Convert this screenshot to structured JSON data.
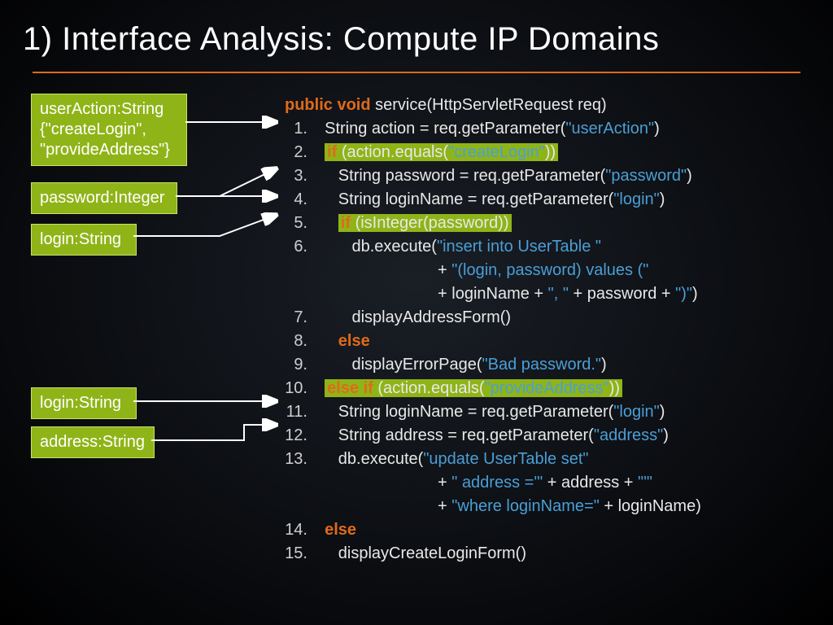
{
  "title": "1) Interface Analysis: Compute IP Domains",
  "boxes": {
    "userAction": "userAction:String {\"createLogin\", \"provideAddress\"}",
    "password": "password:Integer",
    "login1": "login:String",
    "login2": "login:String",
    "address": "address:String"
  },
  "code": {
    "sig": {
      "pre": "public void",
      "rest": " service(HttpServletRequest req)"
    },
    "l1": {
      "n": "1.",
      "a": "String action = req.getParameter(",
      "s": "\"userAction\"",
      "b": ")"
    },
    "l2": {
      "n": "2.",
      "kw": "if",
      "a": " (action.equals(",
      "s": "\"createLogin\"",
      "b": "))"
    },
    "l3": {
      "n": "3.",
      "a": "String password = req.getParameter(",
      "s": "\"password\"",
      "b": ")"
    },
    "l4": {
      "n": "4.",
      "a": "String loginName = req.getParameter(",
      "s": "\"login\"",
      "b": ")"
    },
    "l5": {
      "n": "5.",
      "kw": "if",
      "a": " (isInteger(password))"
    },
    "l6": {
      "n": "6.",
      "a": "db.execute(",
      "s": "\"insert into UserTable \""
    },
    "l6b": {
      "a": "+ ",
      "s": "\"(login, password) values (\""
    },
    "l6c": {
      "a": "+ loginName + ",
      "s1": "\", \"",
      "b": " + password + ",
      "s2": "\")\"",
      "c": ")"
    },
    "l7": {
      "n": "7.",
      "a": "displayAddressForm()"
    },
    "l8": {
      "n": "8.",
      "kw": "else"
    },
    "l9": {
      "n": "9.",
      "a": "displayErrorPage(",
      "s": "\"Bad password.\"",
      "b": ")"
    },
    "l10": {
      "n": "10.",
      "kw": "else if",
      "a": " (action.equals(",
      "s": "\"provideAddress\"",
      "b": "))"
    },
    "l11": {
      "n": "11.",
      "a": "String loginName = req.getParameter(",
      "s": "\"login\"",
      "b": ")"
    },
    "l12": {
      "n": "12.",
      "a": "String address = req.getParameter(",
      "s": "\"address\"",
      "b": ")"
    },
    "l13": {
      "n": "13.",
      "a": "db.execute(",
      "s": "\"update UserTable set\""
    },
    "l13b": {
      "a": "+ ",
      "s1": "\" address ='\"",
      "b": " + address + ",
      "s2": "\"'\""
    },
    "l13c": {
      "a": "+ ",
      "s": "\"where loginName=\"",
      "b": " + loginName)"
    },
    "l14": {
      "n": "14.",
      "kw": "else"
    },
    "l15": {
      "n": "15.",
      "a": "displayCreateLoginForm()"
    }
  }
}
